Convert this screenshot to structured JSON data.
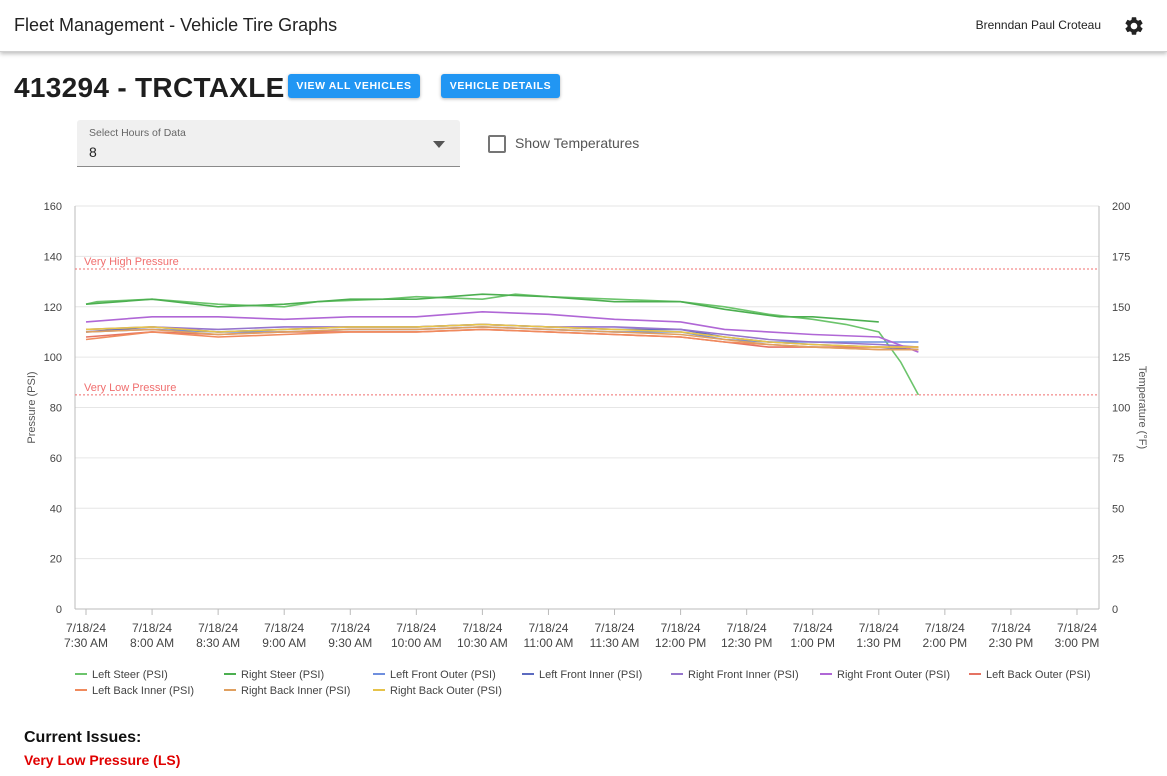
{
  "app": {
    "title": "Fleet Management - Vehicle Tire Graphs",
    "user": "Brenndan Paul Croteau",
    "settings_icon": "gear-icon"
  },
  "vehicle": {
    "title": "413294 - TRCTAXLE",
    "view_all_label": "VIEW ALL VEHICLES",
    "details_label": "VEHICLE DETAILS"
  },
  "hours_select": {
    "label": "Select Hours of Data",
    "value": "8"
  },
  "temperatures": {
    "label": "Show Temperatures",
    "checked": false
  },
  "colors": {
    "accent": "#2196f3",
    "issue": "#e00000",
    "threshold": "#f06e6e"
  },
  "chart_data": {
    "type": "line",
    "ylabel": "Pressure (PSI)",
    "y2label": "Temperature (°F)",
    "ylim": [
      0,
      160
    ],
    "y2lim": [
      0,
      200
    ],
    "yticks": [
      0,
      20,
      40,
      60,
      80,
      100,
      120,
      140,
      160
    ],
    "y2ticks": [
      0,
      25,
      50,
      75,
      100,
      125,
      150,
      175,
      200
    ],
    "xticks": [
      {
        "x": "07:30",
        "date": "7/18/24",
        "time": "7:30 AM"
      },
      {
        "x": "08:00",
        "date": "7/18/24",
        "time": "8:00 AM"
      },
      {
        "x": "08:30",
        "date": "7/18/24",
        "time": "8:30 AM"
      },
      {
        "x": "09:00",
        "date": "7/18/24",
        "time": "9:00 AM"
      },
      {
        "x": "09:30",
        "date": "7/18/24",
        "time": "9:30 AM"
      },
      {
        "x": "10:00",
        "date": "7/18/24",
        "time": "10:00 AM"
      },
      {
        "x": "10:30",
        "date": "7/18/24",
        "time": "10:30 AM"
      },
      {
        "x": "11:00",
        "date": "7/18/24",
        "time": "11:00 AM"
      },
      {
        "x": "11:30",
        "date": "7/18/24",
        "time": "11:30 AM"
      },
      {
        "x": "12:00",
        "date": "7/18/24",
        "time": "12:00 PM"
      },
      {
        "x": "12:30",
        "date": "7/18/24",
        "time": "12:30 PM"
      },
      {
        "x": "13:00",
        "date": "7/18/24",
        "time": "1:00 PM"
      },
      {
        "x": "13:30",
        "date": "7/18/24",
        "time": "1:30 PM"
      },
      {
        "x": "14:00",
        "date": "7/18/24",
        "time": "2:00 PM"
      },
      {
        "x": "14:30",
        "date": "7/18/24",
        "time": "2:30 PM"
      },
      {
        "x": "15:00",
        "date": "7/18/24",
        "time": "3:00 PM"
      }
    ],
    "xlim": [
      "07:25",
      "15:10"
    ],
    "grid": true,
    "legend_position": "bottom",
    "thresholds": [
      {
        "label": "Very High Pressure",
        "value": 135
      },
      {
        "label": "Very Low Pressure",
        "value": 85
      }
    ],
    "series": [
      {
        "name": "Left Steer (PSI)",
        "color": "#6cc46c",
        "points": [
          [
            "07:30",
            121
          ],
          [
            "07:35",
            122
          ],
          [
            "08:00",
            123
          ],
          [
            "08:30",
            121
          ],
          [
            "09:00",
            120
          ],
          [
            "09:15",
            122
          ],
          [
            "09:45",
            123
          ],
          [
            "10:00",
            124
          ],
          [
            "10:30",
            123
          ],
          [
            "10:45",
            125
          ],
          [
            "11:00",
            124
          ],
          [
            "11:30",
            123
          ],
          [
            "12:00",
            122
          ],
          [
            "12:20",
            120
          ],
          [
            "12:40",
            117
          ],
          [
            "13:00",
            115
          ],
          [
            "13:15",
            113
          ],
          [
            "13:30",
            110
          ],
          [
            "13:40",
            98
          ],
          [
            "13:48",
            85
          ]
        ]
      },
      {
        "name": "Right Steer (PSI)",
        "color": "#4caf50",
        "points": [
          [
            "07:30",
            121
          ],
          [
            "08:00",
            123
          ],
          [
            "08:30",
            120
          ],
          [
            "09:00",
            121
          ],
          [
            "09:30",
            123
          ],
          [
            "10:00",
            123
          ],
          [
            "10:30",
            125
          ],
          [
            "11:00",
            124
          ],
          [
            "11:30",
            122
          ],
          [
            "12:00",
            122
          ],
          [
            "12:20",
            119
          ],
          [
            "12:45",
            116
          ],
          [
            "13:00",
            116
          ],
          [
            "13:15",
            115
          ],
          [
            "13:30",
            114
          ]
        ]
      },
      {
        "name": "Left Front Outer (PSI)",
        "color": "#6f8fde",
        "points": [
          [
            "07:30",
            110
          ],
          [
            "08:00",
            111
          ],
          [
            "08:30",
            110
          ],
          [
            "09:00",
            110
          ],
          [
            "09:30",
            111
          ],
          [
            "10:00",
            111
          ],
          [
            "10:30",
            112
          ],
          [
            "11:00",
            111
          ],
          [
            "11:30",
            110
          ],
          [
            "12:00",
            110
          ],
          [
            "12:20",
            107
          ],
          [
            "12:40",
            106
          ],
          [
            "13:00",
            106
          ],
          [
            "13:30",
            106
          ],
          [
            "13:48",
            106
          ]
        ]
      },
      {
        "name": "Left Front Inner (PSI)",
        "color": "#5c6bc0",
        "points": [
          [
            "07:30",
            110
          ],
          [
            "08:00",
            112
          ],
          [
            "08:30",
            110
          ],
          [
            "09:00",
            111
          ],
          [
            "09:30",
            112
          ],
          [
            "10:00",
            112
          ],
          [
            "10:30",
            113
          ],
          [
            "11:00",
            112
          ],
          [
            "11:30",
            111
          ],
          [
            "12:00",
            111
          ],
          [
            "12:20",
            108
          ],
          [
            "12:40",
            106
          ],
          [
            "13:00",
            105
          ],
          [
            "13:30",
            104
          ],
          [
            "13:48",
            103
          ]
        ]
      },
      {
        "name": "Right Front Inner (PSI)",
        "color": "#9575cd",
        "points": [
          [
            "07:30",
            111
          ],
          [
            "08:00",
            112
          ],
          [
            "08:30",
            111
          ],
          [
            "09:00",
            112
          ],
          [
            "09:30",
            112
          ],
          [
            "10:00",
            112
          ],
          [
            "10:30",
            113
          ],
          [
            "11:00",
            112
          ],
          [
            "11:30",
            112
          ],
          [
            "12:00",
            111
          ],
          [
            "12:20",
            109
          ],
          [
            "12:40",
            107
          ],
          [
            "13:00",
            106
          ],
          [
            "13:30",
            105
          ],
          [
            "13:48",
            104
          ]
        ]
      },
      {
        "name": "Right Front Outer (PSI)",
        "color": "#b067d6",
        "points": [
          [
            "07:30",
            114
          ],
          [
            "08:00",
            116
          ],
          [
            "08:30",
            116
          ],
          [
            "09:00",
            115
          ],
          [
            "09:30",
            116
          ],
          [
            "10:00",
            116
          ],
          [
            "10:30",
            118
          ],
          [
            "11:00",
            117
          ],
          [
            "11:30",
            115
          ],
          [
            "12:00",
            114
          ],
          [
            "12:20",
            111
          ],
          [
            "12:40",
            110
          ],
          [
            "13:00",
            109
          ],
          [
            "13:30",
            108
          ],
          [
            "13:48",
            102
          ]
        ]
      },
      {
        "name": "Left Back Outer (PSI)",
        "color": "#e57363",
        "points": [
          [
            "07:30",
            108
          ],
          [
            "08:00",
            110
          ],
          [
            "08:30",
            109
          ],
          [
            "09:00",
            110
          ],
          [
            "09:30",
            110
          ],
          [
            "10:00",
            110
          ],
          [
            "10:30",
            111
          ],
          [
            "11:00",
            110
          ],
          [
            "11:30",
            109
          ],
          [
            "12:00",
            108
          ],
          [
            "12:20",
            106
          ],
          [
            "12:40",
            104
          ],
          [
            "13:00",
            104
          ],
          [
            "13:30",
            104
          ],
          [
            "13:48",
            104
          ]
        ]
      },
      {
        "name": "Left Back Inner (PSI)",
        "color": "#f08a5d",
        "points": [
          [
            "07:30",
            107
          ],
          [
            "08:00",
            110
          ],
          [
            "08:30",
            108
          ],
          [
            "09:00",
            109
          ],
          [
            "09:30",
            110
          ],
          [
            "10:00",
            110
          ],
          [
            "10:30",
            111
          ],
          [
            "11:00",
            110
          ],
          [
            "11:30",
            109
          ],
          [
            "12:00",
            108
          ],
          [
            "12:20",
            106
          ],
          [
            "12:40",
            105
          ],
          [
            "13:00",
            104
          ],
          [
            "13:30",
            103
          ],
          [
            "13:48",
            103
          ]
        ]
      },
      {
        "name": "Right Back Inner (PSI)",
        "color": "#e0a060",
        "points": [
          [
            "07:30",
            110
          ],
          [
            "08:00",
            111
          ],
          [
            "08:30",
            109
          ],
          [
            "09:00",
            110
          ],
          [
            "09:30",
            111
          ],
          [
            "10:00",
            111
          ],
          [
            "10:30",
            112
          ],
          [
            "11:00",
            111
          ],
          [
            "11:30",
            110
          ],
          [
            "12:00",
            109
          ],
          [
            "12:20",
            107
          ],
          [
            "12:40",
            105
          ],
          [
            "13:00",
            104
          ],
          [
            "13:30",
            103
          ],
          [
            "13:48",
            103
          ]
        ]
      },
      {
        "name": "Right Back Outer (PSI)",
        "color": "#e6c34a",
        "points": [
          [
            "07:30",
            111
          ],
          [
            "08:00",
            112
          ],
          [
            "08:30",
            110
          ],
          [
            "09:00",
            111
          ],
          [
            "09:30",
            112
          ],
          [
            "10:00",
            112
          ],
          [
            "10:30",
            113
          ],
          [
            "11:00",
            112
          ],
          [
            "11:30",
            111
          ],
          [
            "12:00",
            110
          ],
          [
            "12:20",
            108
          ],
          [
            "12:40",
            106
          ],
          [
            "13:00",
            105
          ],
          [
            "13:30",
            104
          ],
          [
            "13:48",
            104
          ]
        ]
      }
    ]
  },
  "issues": {
    "title": "Current Issues:",
    "items": [
      "Very Low Pressure (LS)"
    ]
  }
}
